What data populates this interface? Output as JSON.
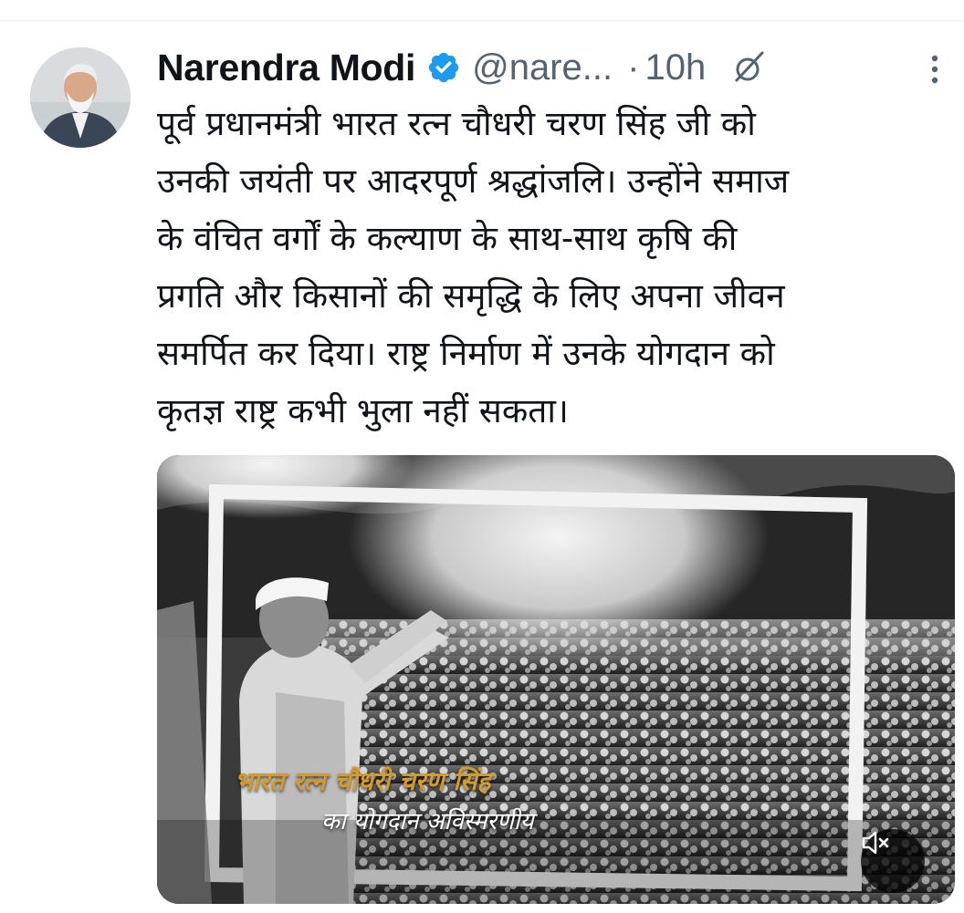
{
  "tweet": {
    "author": {
      "name": "Narendra Modi",
      "handle": "@nare...",
      "verified": true,
      "avatar_icon": "profile-photo"
    },
    "separator": "·",
    "time": "10h",
    "text_lines": [
      "पूर्व प्रधानमंत्री भारत रत्न चौधरी चरण सिंह जी को",
      "उनकी जयंती पर आदरपूर्ण श्रद्धांजलि। उन्होंने समाज",
      "के वंचित वर्गों के कल्याण के साथ-साथ कृषि की",
      "प्रगति और किसानों की समृद्धि के लिए अपना जीवन",
      "समर्पित कर दिया। राष्ट्र निर्माण में उनके योगदान को",
      "कृतज्ञ राष्ट्र कभी भुला नहीं सकता।"
    ],
    "media": {
      "type": "video",
      "caption_line1": "भारत रत्न चौधरी चरण सिंह",
      "caption_line2": "का योगदान अविस्मरणीय",
      "mute_icon": "speaker-muted-icon"
    }
  },
  "colors": {
    "text": "#0f1419",
    "secondary": "#536471",
    "verified": "#1d9bf0",
    "caption_gold": "#d39b2c"
  },
  "icons": {
    "verified": "verified-badge-icon",
    "grok": "grok-icon",
    "more": "more-vertical-icon"
  }
}
